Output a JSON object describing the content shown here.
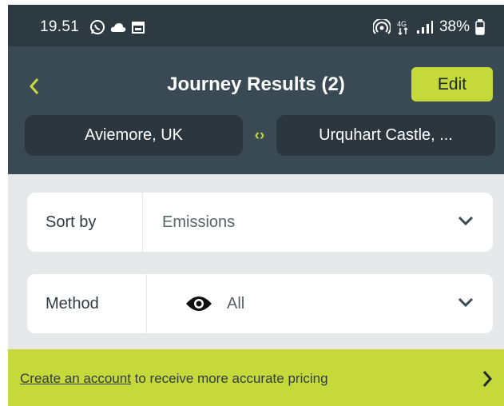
{
  "status_bar": {
    "time": "19.51",
    "battery": "38%",
    "icons_left": [
      "whatsapp-icon",
      "cloud-icon",
      "calendar-icon"
    ],
    "icons_right": [
      "hotspot-icon",
      "4g-icon",
      "signal-icon",
      "battery-icon"
    ]
  },
  "header": {
    "title": "Journey Results (2)",
    "edit_label": "Edit",
    "from": "Aviemore, UK",
    "to": "Urquhart Castle, ..."
  },
  "filters": {
    "sort": {
      "label": "Sort by",
      "value": "Emissions"
    },
    "method": {
      "label": "Method",
      "value": "All"
    }
  },
  "banner": {
    "link_text": "Create an account",
    "text": " to receive more accurate pricing"
  },
  "colors": {
    "header_bg": "#3a4a54",
    "status_bg": "#2d3a42",
    "accent": "#c6d93a",
    "pill_bg": "#2b363e",
    "page_bg": "#e6e8ea"
  }
}
